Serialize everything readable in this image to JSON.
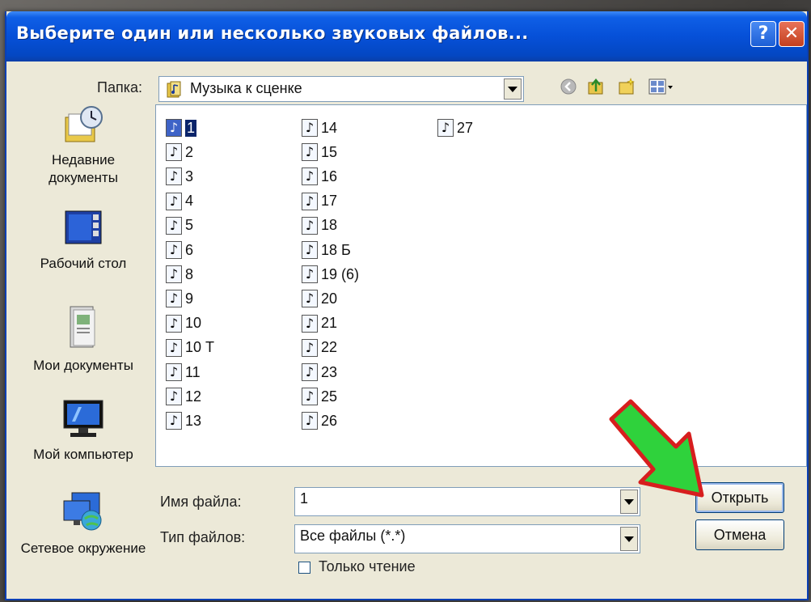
{
  "window": {
    "title": "Выберите один или несколько звуковых файлов...",
    "help_label": "?",
    "close_label": "✕"
  },
  "lookin": {
    "label": "Папка:",
    "value": "Музыка к сценке"
  },
  "places": [
    {
      "label": "Недавние документы",
      "icon": "recent-documents-icon"
    },
    {
      "label": "Рабочий стол",
      "icon": "desktop-icon"
    },
    {
      "label": "Мои документы",
      "icon": "my-documents-icon"
    },
    {
      "label": "Мой компьютер",
      "icon": "my-computer-icon"
    },
    {
      "label": "Сетевое окружение",
      "icon": "network-icon"
    }
  ],
  "files": {
    "col1": [
      "1",
      "2",
      "3",
      "4",
      "5",
      "6",
      "8",
      "9",
      "10",
      "10 Т",
      "11",
      "12",
      "13"
    ],
    "col2": [
      "14",
      "15",
      "16",
      "17",
      "18",
      "18 Б",
      "19 (6)",
      "20",
      "21",
      "22",
      "23",
      "25",
      "26"
    ],
    "col3": [
      "27"
    ],
    "selected": "1",
    "icon": "audio-file-icon"
  },
  "filename": {
    "label": "Имя файла:",
    "value": "1"
  },
  "filetype": {
    "label": "Тип файлов:",
    "value": "Все файлы (*.*)"
  },
  "readonly": {
    "label": "Только чтение",
    "checked": false
  },
  "buttons": {
    "open": "Открыть",
    "cancel": "Отмена"
  },
  "colors": {
    "titlebar": "#0650d8",
    "arrow_fill": "#2fd23c",
    "arrow_stroke": "#d71e1e",
    "selection": "#0a246a"
  }
}
